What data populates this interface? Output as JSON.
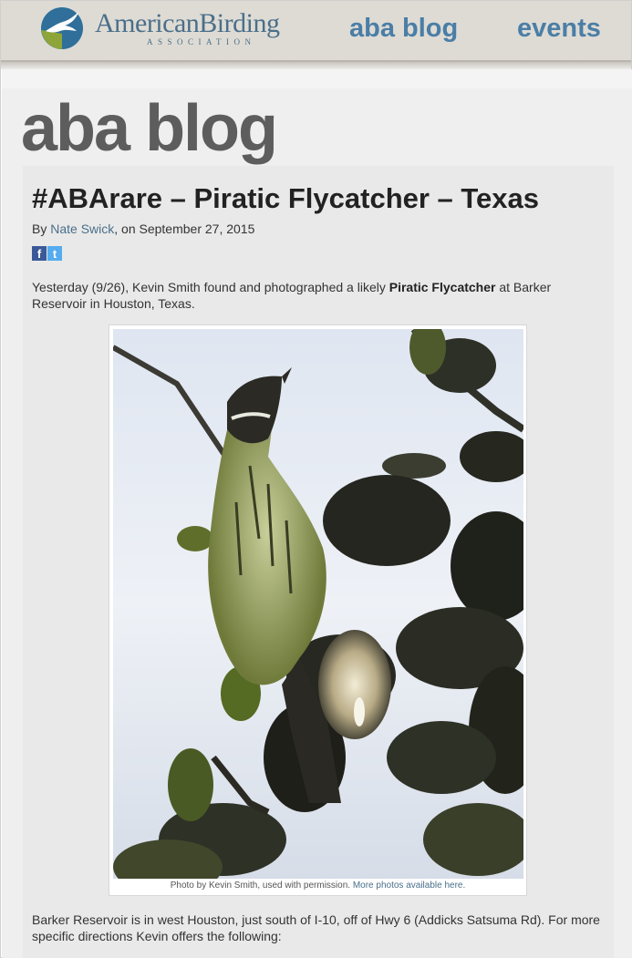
{
  "header": {
    "logo_word": "AmericanBirding",
    "logo_sub": "ASSOCIATION",
    "nav": {
      "blog": "aba blog",
      "events": "events"
    }
  },
  "section_title": "aba blog",
  "post": {
    "title": "#ABArare – Piratic Flycatcher – Texas",
    "by_prefix": "By ",
    "author": "Nate Swick",
    "date_text": ", on September 27, 2015",
    "share": {
      "facebook_glyph": "f",
      "twitter_glyph": "t"
    },
    "intro_before": "Yesterday (9/26), Kevin Smith found and photographed a likely ",
    "intro_bold": "Piratic Flycatcher",
    "intro_after": " at Barker Reservoir in Houston, Texas.",
    "caption_text": "Photo by Kevin Smith, used with permission. ",
    "caption_link": "More photos available here.",
    "para2": "Barker Reservoir is in west Houston, just south of I-10, off of Hwy 6 (Addicks Satsuma Rd). For more specific directions Kevin offers the following:"
  },
  "colors": {
    "link": "#4a6f8a",
    "nav": "#4a7ea6",
    "header_bg": "#dedbd4",
    "facebook": "#3b5998",
    "twitter": "#55acee"
  },
  "icons": [
    "aba-logo-icon",
    "facebook-icon",
    "twitter-icon"
  ]
}
